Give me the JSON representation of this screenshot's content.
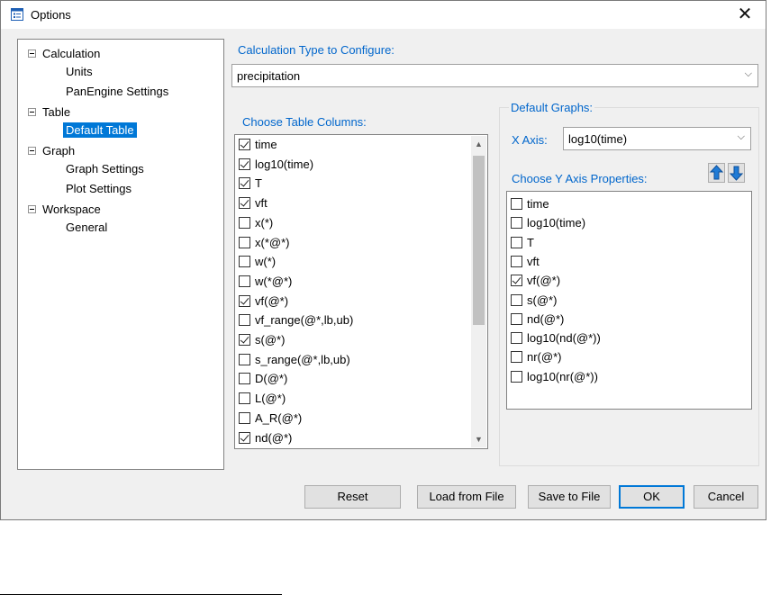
{
  "window": {
    "title": "Options",
    "title_icon": "options-window-icon",
    "close_glyph": "✕"
  },
  "tree": [
    {
      "label": "Calculation",
      "expanded": true,
      "children": [
        "Units",
        "PanEngine Settings"
      ]
    },
    {
      "label": "Table",
      "expanded": true,
      "children": [
        "Default Table"
      ],
      "selected": "Default Table"
    },
    {
      "label": "Graph",
      "expanded": true,
      "children": [
        "Graph Settings",
        "Plot Settings"
      ]
    },
    {
      "label": "Workspace",
      "expanded": true,
      "children": [
        "General"
      ]
    }
  ],
  "calc_type": {
    "label": "Calculation Type to Configure:",
    "value": "precipitation"
  },
  "table_columns": {
    "label": "Choose Table Columns:",
    "items": [
      {
        "label": "time",
        "checked": true
      },
      {
        "label": "log10(time)",
        "checked": true
      },
      {
        "label": "T",
        "checked": true
      },
      {
        "label": "vft",
        "checked": true
      },
      {
        "label": "x(*)",
        "checked": false
      },
      {
        "label": "x(*@*)",
        "checked": false
      },
      {
        "label": "w(*)",
        "checked": false
      },
      {
        "label": "w(*@*)",
        "checked": false
      },
      {
        "label": "vf(@*)",
        "checked": true
      },
      {
        "label": "vf_range(@*,lb,ub)",
        "checked": false
      },
      {
        "label": "s(@*)",
        "checked": true
      },
      {
        "label": "s_range(@*,lb,ub)",
        "checked": false
      },
      {
        "label": "D(@*)",
        "checked": false
      },
      {
        "label": "L(@*)",
        "checked": false
      },
      {
        "label": "A_R(@*)",
        "checked": false
      },
      {
        "label": "nd(@*)",
        "checked": true
      }
    ]
  },
  "default_graphs": {
    "label": "Default Graphs:",
    "x_axis_label": "X Axis:",
    "x_axis_value": "log10(time)",
    "y_axis_label": "Choose Y Axis Properties:",
    "move_up_icon": "arrow-up-icon",
    "move_down_icon": "arrow-down-icon",
    "y_items": [
      {
        "label": "time",
        "checked": false
      },
      {
        "label": "log10(time)",
        "checked": false
      },
      {
        "label": "T",
        "checked": false
      },
      {
        "label": "vft",
        "checked": false
      },
      {
        "label": "vf(@*)",
        "checked": true
      },
      {
        "label": "s(@*)",
        "checked": false
      },
      {
        "label": "nd(@*)",
        "checked": false
      },
      {
        "label": "log10(nd(@*))",
        "checked": false
      },
      {
        "label": "nr(@*)",
        "checked": false
      },
      {
        "label": "log10(nr(@*))",
        "checked": false
      }
    ]
  },
  "buttons": {
    "reset": "Reset",
    "load": "Load from File",
    "save": "Save to File",
    "ok": "OK",
    "cancel": "Cancel"
  },
  "colors": {
    "accent": "#0078d7",
    "group_label": "#0066cc",
    "arrow_blue": "#1f7bd6"
  }
}
